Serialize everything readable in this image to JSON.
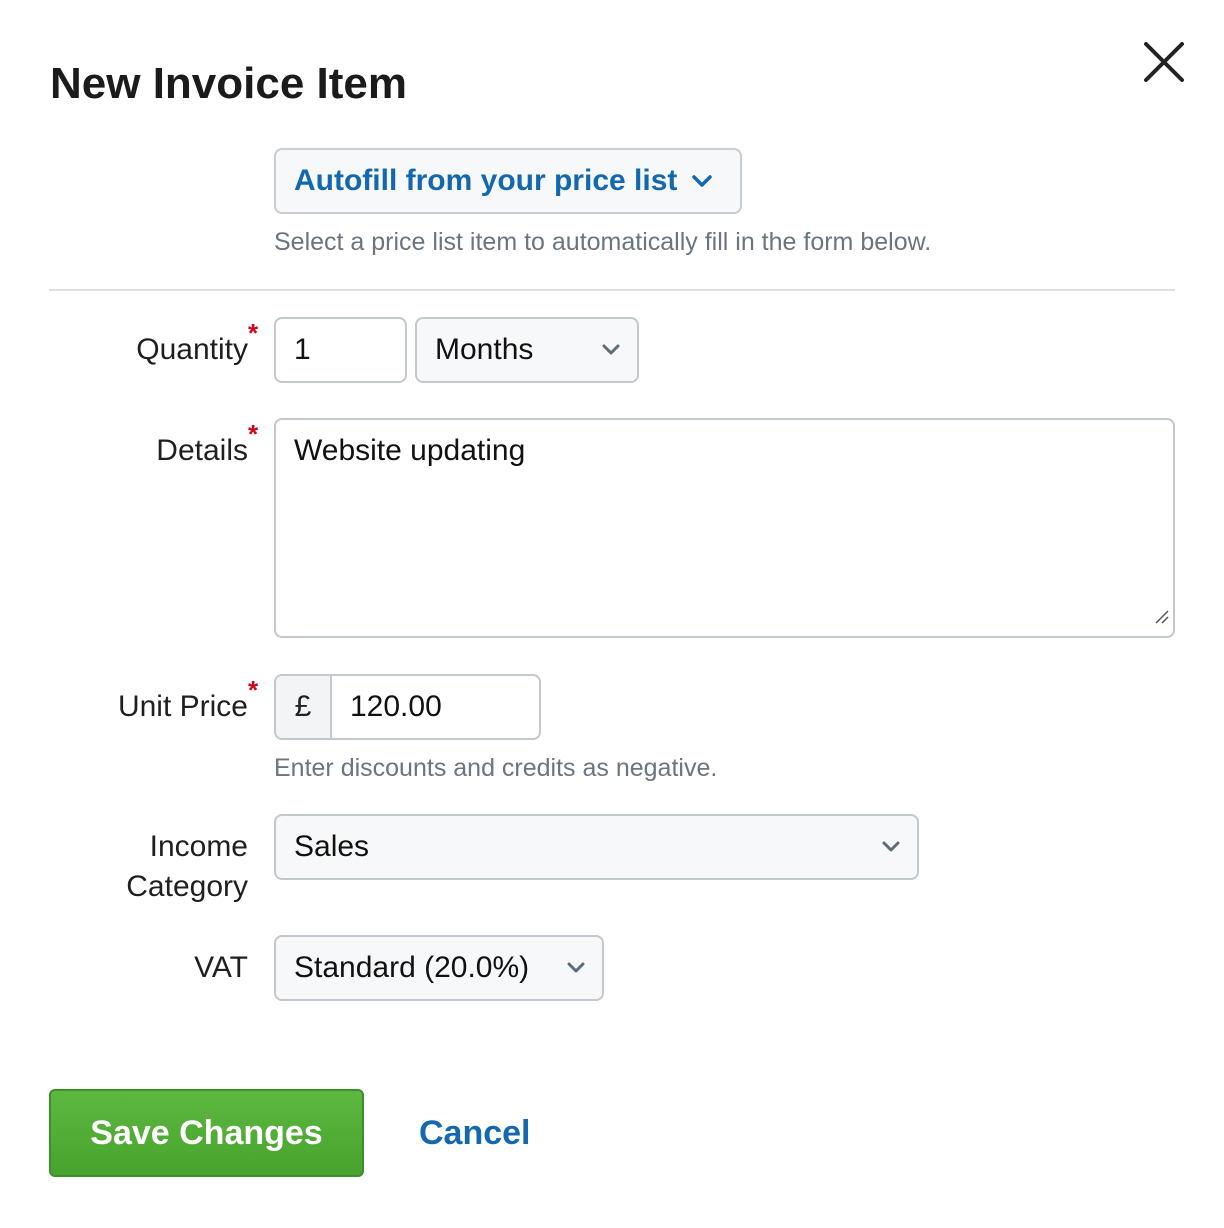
{
  "dialog": {
    "title": "New Invoice Item",
    "close_icon": "close-icon"
  },
  "autofill": {
    "label": "Autofill from your price list",
    "icon": "chevron-down-icon",
    "hint": "Select a price list item to automatically fill in the form below."
  },
  "form": {
    "quantity": {
      "label": "Quantity",
      "required": "*",
      "value": "1",
      "unit": "Months"
    },
    "details": {
      "label": "Details",
      "required": "*",
      "value": "Website updating"
    },
    "unit_price": {
      "label": "Unit Price",
      "required": "*",
      "currency_symbol": "£",
      "value": "120.00",
      "hint": "Enter discounts and credits as negative."
    },
    "income_category": {
      "label_line1": "Income",
      "label_line2": "Category",
      "value": "Sales"
    },
    "vat": {
      "label": "VAT",
      "value": "Standard (20.0%)"
    }
  },
  "actions": {
    "save_label": "Save Changes",
    "cancel_label": "Cancel"
  },
  "colors": {
    "primary_link": "#1468b0",
    "save_button": "#52ad37",
    "required_marker": "#d0021b"
  }
}
